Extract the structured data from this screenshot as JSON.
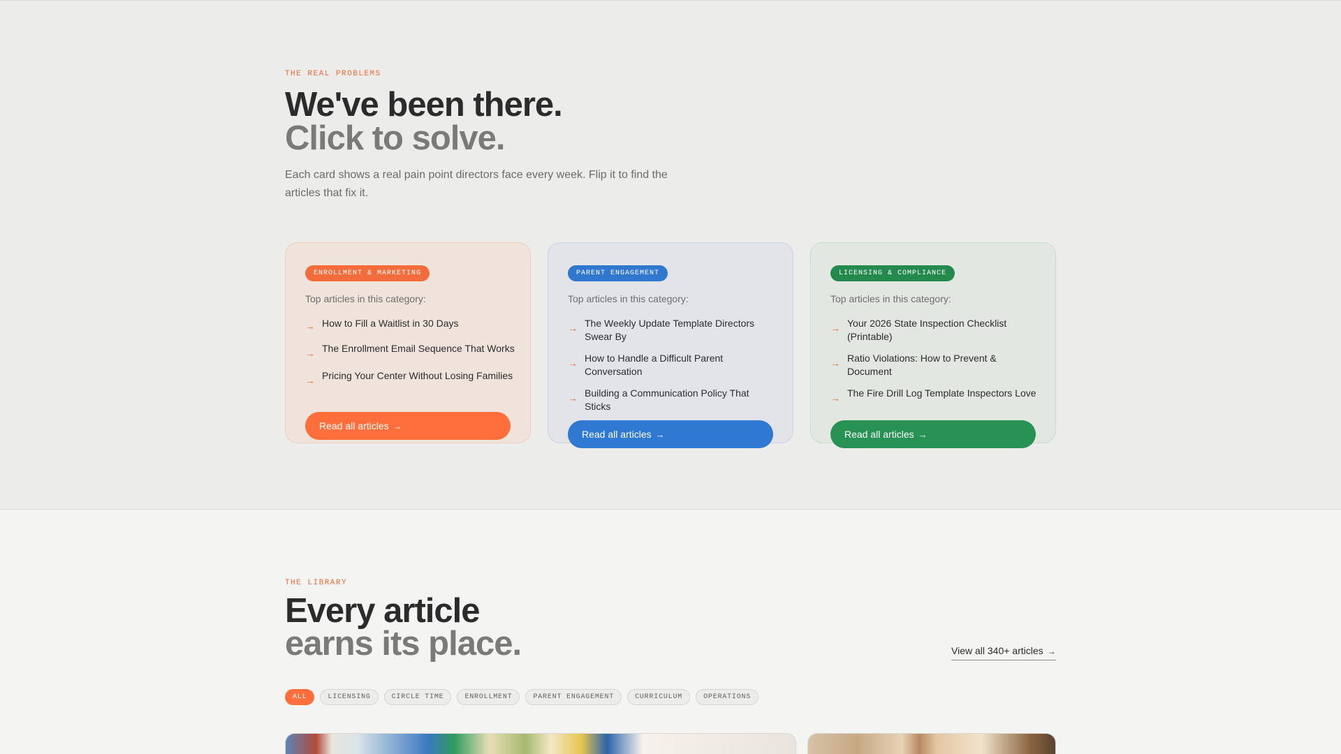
{
  "problems": {
    "eyebrow": "THE REAL PROBLEMS",
    "heading_line1": "We've been there.",
    "heading_line2": "Click to solve.",
    "lede": "Each card shows a real pain point directors face every week. Flip it to find the articles that fix it."
  },
  "cards": [
    {
      "tag": "ENROLLMENT & MARKETING",
      "intro": "Top articles in this category:",
      "articles": [
        "How to Fill a Waitlist in 30 Days",
        "The Enrollment Email Sequence That Works",
        "Pricing Your Center Without Losing Families"
      ],
      "cta": "Read all articles",
      "accent": "#ff6e3b"
    },
    {
      "tag": "PARENT ENGAGEMENT",
      "intro": "Top articles in this category:",
      "articles": [
        "The Weekly Update Template Directors Swear By",
        "How to Handle a Difficult Parent Conversation",
        "Building a Communication Policy That Sticks"
      ],
      "cta": "Read all articles",
      "accent": "#2f79d2"
    },
    {
      "tag": "LICENSING & COMPLIANCE",
      "intro": "Top articles in this category:",
      "articles": [
        "Your 2026 State Inspection Checklist (Printable)",
        "Ratio Violations: How to Prevent & Document",
        "The Fire Drill Log Template Inspectors Love"
      ],
      "cta": "Read all articles",
      "accent": "#279253"
    }
  ],
  "arrow_glyph": "→",
  "library": {
    "eyebrow": "THE LIBRARY",
    "heading_line1": "Every article",
    "heading_line2": "earns its place.",
    "view_all": "View all 340+ articles",
    "filters": [
      "ALL",
      "LICENSING",
      "CIRCLE TIME",
      "ENROLLMENT",
      "PARENT ENGAGEMENT",
      "CURRICULUM",
      "OPERATIONS"
    ],
    "active_filter": "ALL"
  }
}
